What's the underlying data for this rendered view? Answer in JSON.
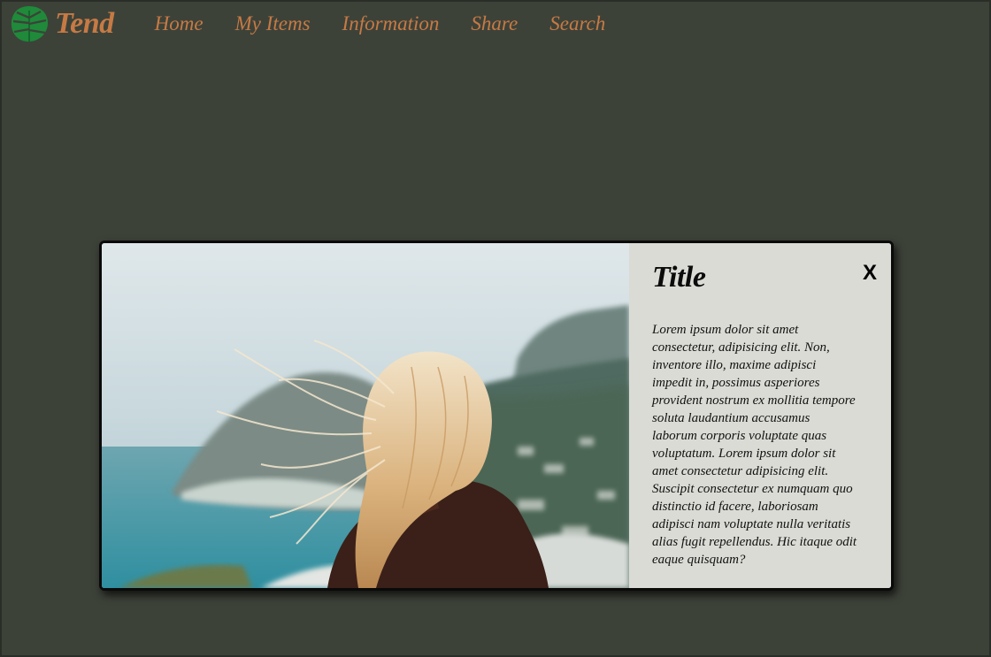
{
  "brand": {
    "name": "Tend",
    "logo_icon": "monstera-leaf-icon",
    "logo_color": "#1f8a3a"
  },
  "nav": {
    "items": [
      {
        "label": "Home"
      },
      {
        "label": "My Items"
      },
      {
        "label": "Information"
      },
      {
        "label": "Share"
      },
      {
        "label": "Search"
      }
    ]
  },
  "modal": {
    "title": "Title",
    "close_label": "X",
    "body": "Lorem ipsum dolor sit amet consectetur, adipisicing elit. Non, inventore illo, maxime adipisci impedit in, possimus asperiores provident nostrum ex mollitia tempore soluta laudantium accusamus laborum corporis voluptate quas voluptatum. Lorem ipsum dolor sit amet consectetur adipisicing elit. Suscipit consectetur ex numquam quo distinctio id facere, laboriosam adipisci nam voluptate nulla veritatis alias fugit repellendus. Hic itaque odit eaque quisquam?",
    "image_icon": "photo-woman-windblown-hair-coast"
  },
  "colors": {
    "background": "#3d4239",
    "accent": "#c67a44",
    "panel": "#dadbd5"
  }
}
